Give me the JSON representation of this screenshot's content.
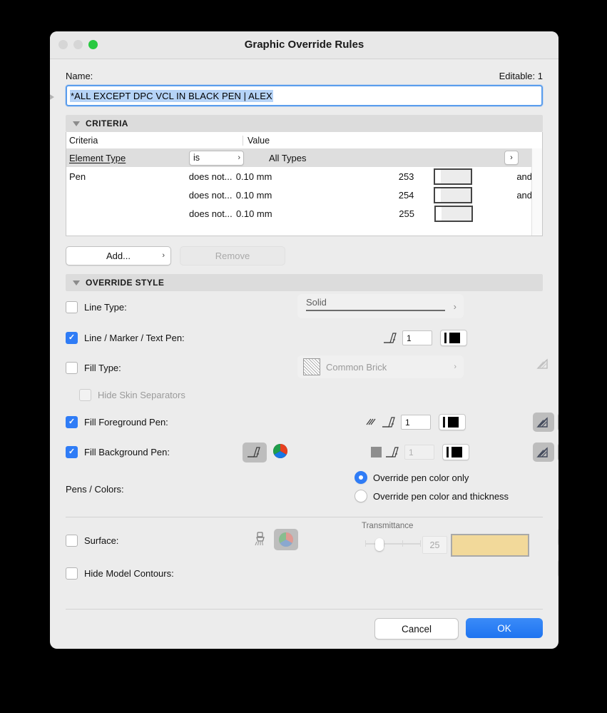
{
  "window": {
    "title": "Graphic Override Rules",
    "traffic_lights": [
      "close-light",
      "minimize-light",
      "zoom-light"
    ]
  },
  "name_section": {
    "label": "Name:",
    "editable": "Editable: 1",
    "value": "*ALL EXCEPT DPC VCL IN BLACK PEN | ALEX"
  },
  "criteria": {
    "header": "CRITERIA",
    "columns": {
      "criteria": "Criteria",
      "operator": "",
      "value": "Value"
    },
    "rows": [
      {
        "name": "Element Type",
        "operator": "is",
        "value": "All Types",
        "number": "",
        "conjunction": "",
        "selected": true,
        "has_arrow": true
      },
      {
        "name": "Pen",
        "operator": "does not...",
        "value": "0.10 mm",
        "number": "253",
        "conjunction": "and",
        "selected": false,
        "has_arrow": false
      },
      {
        "name": "",
        "operator": "does not...",
        "value": "0.10 mm",
        "number": "254",
        "conjunction": "and",
        "selected": false,
        "has_arrow": false
      },
      {
        "name": "",
        "operator": "does not...",
        "value": "0.10 mm",
        "number": "255",
        "conjunction": "",
        "selected": false,
        "has_arrow": false
      }
    ],
    "add_button": "Add...",
    "remove_button": "Remove"
  },
  "override_style": {
    "header": "OVERRIDE STYLE",
    "line_type": {
      "label": "Line Type:",
      "checked": false,
      "value": "Solid"
    },
    "line_marker_text_pen": {
      "label": "Line / Marker / Text Pen:",
      "checked": true,
      "pen": "1",
      "color": "#000000"
    },
    "fill_type": {
      "label": "Fill Type:",
      "checked": false,
      "value": "Common Brick"
    },
    "hide_skin_separators": {
      "label": "Hide Skin Separators",
      "checked": false
    },
    "fill_foreground_pen": {
      "label": "Fill Foreground Pen:",
      "checked": true,
      "pen": "1",
      "color": "#000000"
    },
    "fill_background_pen": {
      "label": "Fill Background Pen:",
      "checked": true,
      "pen": "1",
      "color": "#000000"
    },
    "pens_colors": {
      "label": "Pens / Colors:",
      "option_color_only": "Override pen color only",
      "option_color_and_thickness": "Override pen color and thickness",
      "selected": "color_only"
    },
    "surface": {
      "label": "Surface:",
      "checked": false,
      "transmittance_label": "Transmittance",
      "transmittance_value": "25",
      "surface_color": "#f2d99a"
    },
    "hide_model_contours": {
      "label": "Hide Model Contours:",
      "checked": false
    }
  },
  "footer": {
    "cancel": "Cancel",
    "ok": "OK"
  },
  "icons": {
    "cut_fill": "cut-fill-icon",
    "cover_fill": "cover-fill-icon",
    "drafting_fill": "drafting-fill-icon",
    "pen_icon": "pen-nib-icon",
    "color_wheel": "color-wheel-icon",
    "brush": "brush-icon",
    "surface_3d": "surface-3d-icon",
    "surface_2d": "surface-2d-icon",
    "hide_contour_3d": "hide-contour-3d-icon",
    "hide_contour_2d": "hide-contour-2d-icon"
  }
}
